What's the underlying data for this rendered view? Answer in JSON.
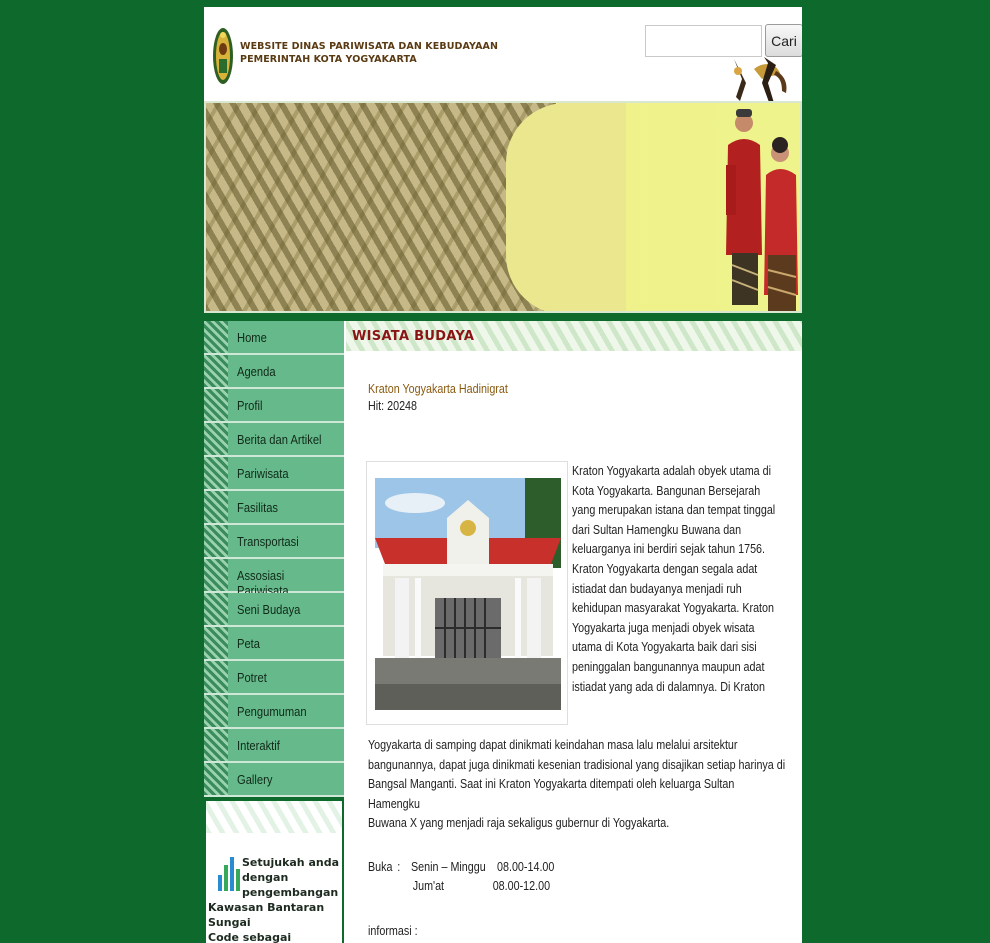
{
  "header": {
    "title_line1": "WEBSITE DINAS PARIWISATA DAN KEBUDAYAAN",
    "title_line2": "PEMERINTAH KOTA YOGYAKARTA",
    "search_placeholder": "",
    "search_button": "Cari"
  },
  "nav": {
    "items": [
      {
        "label": "Home"
      },
      {
        "label": "Agenda"
      },
      {
        "label": "Profil"
      },
      {
        "label": "Berita dan Artikel"
      },
      {
        "label": "Pariwisata"
      },
      {
        "label": "Fasilitas"
      },
      {
        "label": "Transportasi"
      },
      {
        "label": "Assosiasi Pariwisata"
      },
      {
        "label": "Seni Budaya"
      },
      {
        "label": "Peta"
      },
      {
        "label": "Potret"
      },
      {
        "label": "Pengumuman"
      },
      {
        "label": "Interaktif"
      },
      {
        "label": "Gallery"
      }
    ]
  },
  "poll": {
    "line1": "Setujukah anda",
    "line2": "dengan",
    "line3": "pengembangan",
    "line4": "Kawasan Bantaran Sungai",
    "line5": "Code sebagai kawasan"
  },
  "content": {
    "section_title": "WISATA BUDAYA",
    "article_title": "Kraton Yogyakarta Hadinigrat",
    "hits": "Hit: 20248",
    "wrapped_lines": [
      "Kraton Yogyakarta adalah obyek utama di",
      "Kota Yogyakarta. Bangunan Bersejarah",
      "yang merupakan istana dan tempat tinggal",
      "dari Sultan Hamengku Buwana dan",
      "keluarganya ini berdiri sejak tahun 1756.",
      "Kraton Yogyakarta dengan segala adat",
      "istiadat dan budayanya menjadi ruh",
      "kehidupan masyarakat Yogyakarta. Kraton",
      "Yogyakarta juga menjadi obyek wisata",
      "utama di Kota Yogyakarta baik dari sisi",
      "peninggalan bangunannya maupun adat",
      "istiadat yang ada di dalamnya. Di Kraton"
    ],
    "full_lines": [
      "Yogyakarta di samping dapat dinikmati keindahan masa lalu melalui arsitektur",
      "bangunannya, dapat juga dinikmati kesenian tradisional yang disajikan setiap harinya di",
      "Bangsal Manganti. Saat ini Kraton Yogyakarta ditempati oleh keluarga Sultan Hamengku",
      "Buwana X yang menjadi raja sekaligus gubernur di Yogyakarta."
    ],
    "hours": {
      "label": "Buka",
      "sep": ":",
      "day1": "Senin – Minggu",
      "time1": "08.00-14.00",
      "day2": "Jum'at",
      "time2": "08.00-12.00"
    },
    "info_label": "informasi :"
  },
  "colors": {
    "background": "#0d6a2c",
    "nav_item": "#66b98b",
    "section_title": "#8a1414",
    "article_title": "#8a5a10"
  }
}
